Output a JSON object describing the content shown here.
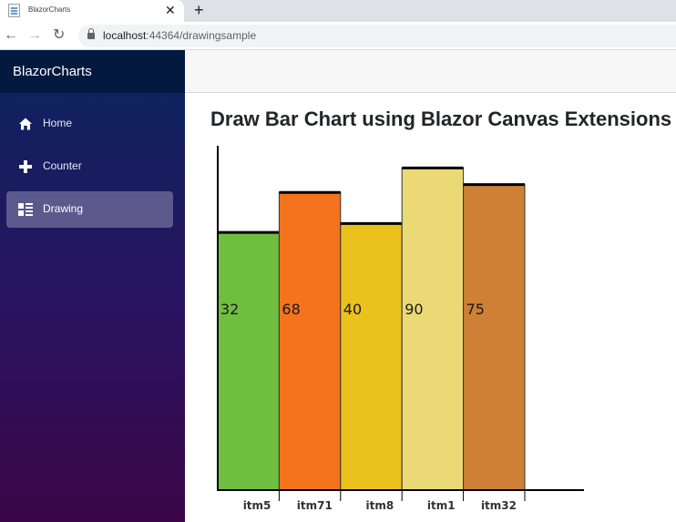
{
  "browser": {
    "tab_title": "BlazorCharts",
    "close_glyph": "✕",
    "new_tab_glyph": "+",
    "url_host": "localhost",
    "url_path": ":44364/drawingsample",
    "back_glyph": "←",
    "forward_glyph": "→",
    "reload_glyph": "↻"
  },
  "app": {
    "brand": "BlazorCharts",
    "nav": [
      {
        "label": "Home",
        "icon": "home-icon",
        "active": false
      },
      {
        "label": "Counter",
        "icon": "plus-icon",
        "active": false
      },
      {
        "label": "Drawing",
        "icon": "list-icon",
        "active": true
      }
    ],
    "page_title": "Draw Bar Chart using Blazor Canvas Extensions"
  },
  "chart_data": {
    "type": "bar",
    "categories": [
      "itm5",
      "itm71",
      "itm8",
      "itm1",
      "itm32"
    ],
    "values": [
      32,
      68,
      40,
      90,
      75
    ],
    "data_labels": [
      "32",
      "68",
      "40",
      "90",
      "75"
    ],
    "colors": [
      "#6fbe3f",
      "#f5731c",
      "#ebc11e",
      "#ebd975",
      "#cd8036"
    ],
    "ylim": [
      -200,
      110
    ],
    "grid": false,
    "legend": "none",
    "title": ""
  }
}
